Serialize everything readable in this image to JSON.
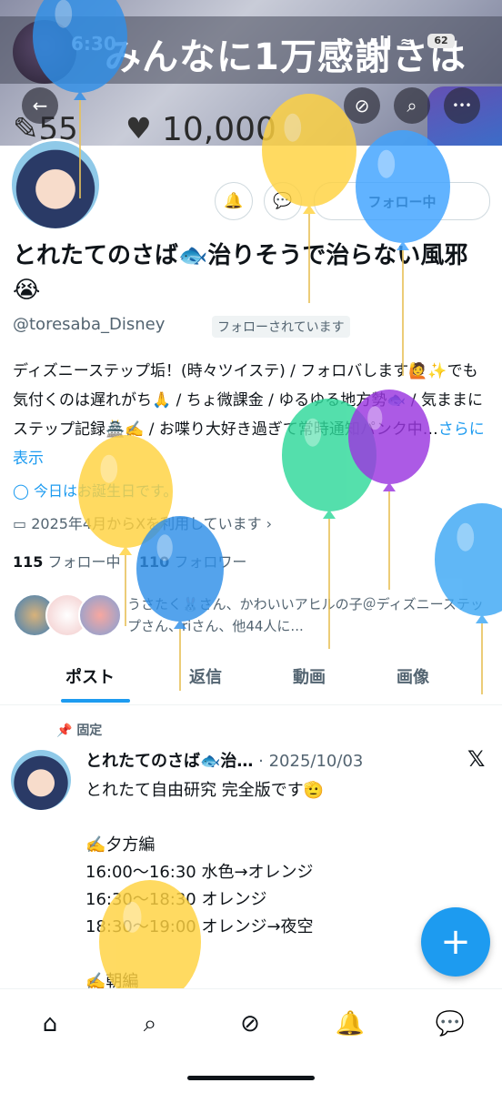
{
  "status_bar": {
    "time": "6:30",
    "icons": "ıll ≈",
    "battery": "62"
  },
  "banner": {
    "text": "みんなに1万感謝さは",
    "stat_left": "✎55",
    "heart": "♥",
    "stat_right": "10,000"
  },
  "header_buttons": {
    "back": "←",
    "grok": "⊘",
    "search": "⌕",
    "more": "•••"
  },
  "profile": {
    "display_name": "とれたてのさば🐟治りそうで治らない風邪😭",
    "handle": "@toresaba_Disney",
    "follows_you": "フォローされています",
    "follow_button": "フォロー中",
    "notify_icon": "🔔",
    "dm_icon": "💬",
    "bio": "ディズニーステップ垢！(時々ツイステ) / フォロバします🙋✨でも気付くのは遅れがち🙏 / ちょ微課金 / ゆるゆる地方勢🐟 / 気ままにステップ記録🏯✍️ / お喋り大好き過ぎて常時通知パンク中…",
    "bio_more": "さらに表示",
    "birthday": "今日はお誕生日です。",
    "joined": "2025年4月からXを利用しています",
    "following_count": "115",
    "following_label": "フォロー中",
    "followers_count": "110",
    "followers_label": "フォロワー",
    "followed_by": "うさたく🐰さん、かわいいアヒルの子＠ディズニーステップさん、riさん、他44人に..."
  },
  "tabs": [
    {
      "label": "ポスト"
    },
    {
      "label": "返信"
    },
    {
      "label": "動画"
    },
    {
      "label": "画像"
    }
  ],
  "pinned_post": {
    "pin_label": "固定",
    "author": "とれたてのさば🐟治…",
    "date": "· 2025/10/03",
    "x_icon": "𝕏",
    "body": "とれたて自由研究  完全版です🫡\n\n✍️夕方編\n16:00〜16:30  水色→オレンジ\n16:30〜18:30  オレンジ\n18:30〜19:00 オレンジ→夜空\n\n✍️朝編"
  },
  "fab": "+",
  "bottom_nav": {
    "home": "⌂",
    "search": "⌕",
    "grok": "⊘",
    "notifications": "🔔",
    "messages": "💬"
  },
  "colors": {
    "accent": "#1d9bf0",
    "text": "#0f1419",
    "muted": "#536471"
  },
  "balloon_colors": [
    "#2f8fe8",
    "#ffd23f",
    "#3fa3ff",
    "#2fd99a",
    "#9b37e0",
    "#3ea8f5",
    "#ffd23f"
  ]
}
